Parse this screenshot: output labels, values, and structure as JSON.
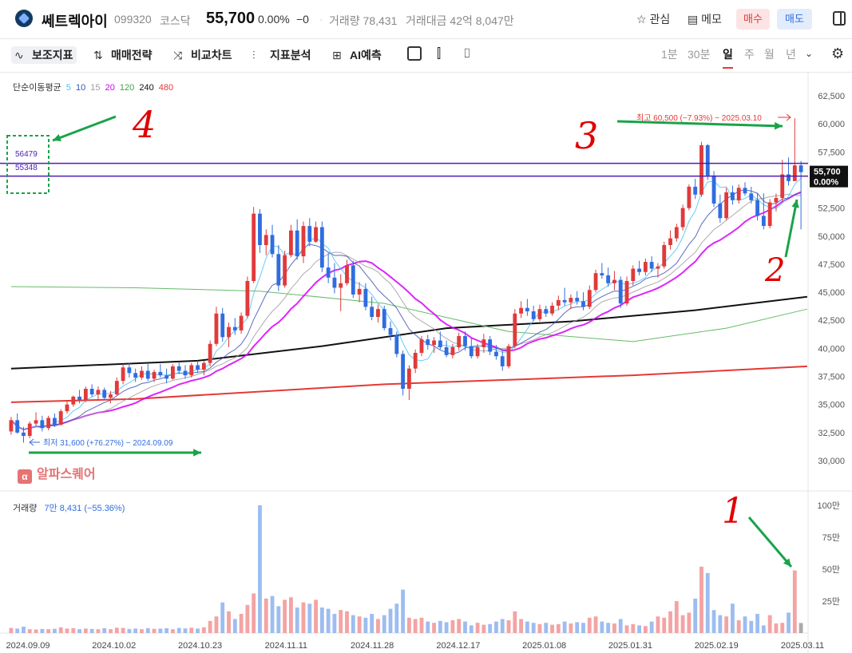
{
  "header": {
    "stock_name": "쎄트렉아이",
    "code": "099320",
    "market": "코스닥",
    "price": "55,700",
    "change_pct": "0.00%",
    "change_abs": "−0",
    "separator": "·",
    "volume": "거래량 78,431",
    "amount": "거래대금 42억 8,047만",
    "watch_label": "관심",
    "memo_label": "메모",
    "buy_label": "매수",
    "sell_label": "매도"
  },
  "toolbar": {
    "items": [
      "보조지표",
      "매매전략",
      "비교차트",
      "지표분석",
      "AI예측"
    ],
    "periods": [
      "1분",
      "30분",
      "일",
      "주",
      "월",
      "년"
    ],
    "selected_period": "일"
  },
  "legend": {
    "ma_title": "단순이동평균",
    "ma_periods": [
      "5",
      "10",
      "15",
      "20",
      "120",
      "240",
      "480"
    ],
    "volume_title": "거래량",
    "volume_value": "7만 8,431 (−55.36%)"
  },
  "watermark": "알파스퀘어",
  "colors": {
    "up": "#e03a3a",
    "down": "#2f6de0",
    "ma5": "#4fc3f7",
    "ma10": "#3f51b5",
    "ma15": "#9e9e9e",
    "ma20": "#d500f9",
    "ma120": "#66bb6a",
    "ma240": "#111111",
    "ma480": "#e53935",
    "annotation": "#e53935",
    "arrow": "#1aa34a"
  },
  "chart_data": {
    "type": "candlestick",
    "y_axis_ticks": [
      "62,500",
      "60,000",
      "57,500",
      "55,000",
      "52,500",
      "50,000",
      "47,500",
      "45,000",
      "42,500",
      "40,000",
      "37,500",
      "35,000",
      "32,500",
      "30,000"
    ],
    "y_range": [
      28500,
      63500
    ],
    "x_axis_labels": [
      "2024.09.09",
      "2024.10.02",
      "2024.10.23",
      "2024.11.11",
      "2024.11.28",
      "2024.12.17",
      "2025.01.08",
      "2025.01.31",
      "2025.02.19",
      "2025.03.11"
    ],
    "current_price_label": "55,700",
    "current_pct_label": "0.00%",
    "high_annotation": "최고 60,500 (−7.93%) − 2025.03.10",
    "low_annotation": "최저 31,600 (+76.27%) − 2024.09.09",
    "horizontal_lines": [
      {
        "label": "56479",
        "value": 56479
      },
      {
        "label": "55348",
        "value": 55348
      }
    ],
    "volume_axis_ticks": [
      "100만",
      "75만",
      "50만",
      "25만"
    ],
    "volume_range": [
      0,
      1000000
    ],
    "hand_annotations": [
      "1",
      "2",
      "3",
      "4"
    ],
    "candles": [
      [
        32600,
        33900,
        32300,
        33600
      ],
      [
        33600,
        34200,
        32400,
        32500
      ],
      [
        32500,
        33000,
        31600,
        32200
      ],
      [
        32200,
        33500,
        32000,
        33300
      ],
      [
        33300,
        34300,
        33100,
        33600
      ],
      [
        33600,
        34000,
        32600,
        32900
      ],
      [
        32900,
        34000,
        32700,
        33800
      ],
      [
        33800,
        34200,
        33000,
        33200
      ],
      [
        33200,
        34600,
        33100,
        34400
      ],
      [
        34400,
        35300,
        34200,
        35000
      ],
      [
        35000,
        35800,
        34800,
        35700
      ],
      [
        35700,
        36300,
        35100,
        35400
      ],
      [
        35400,
        36600,
        35200,
        36400
      ],
      [
        36400,
        36800,
        35700,
        35900
      ],
      [
        35900,
        36600,
        35400,
        36300
      ],
      [
        36300,
        36500,
        35400,
        35600
      ],
      [
        35600,
        36200,
        35100,
        35900
      ],
      [
        35900,
        37400,
        35800,
        37100
      ],
      [
        37100,
        38600,
        36800,
        38300
      ],
      [
        38300,
        38700,
        37400,
        37800
      ],
      [
        37800,
        38200,
        37000,
        37400
      ],
      [
        37400,
        38400,
        37200,
        38000
      ],
      [
        38000,
        38600,
        37100,
        37300
      ],
      [
        37300,
        38100,
        37000,
        37900
      ],
      [
        37900,
        38600,
        37400,
        37600
      ],
      [
        37600,
        38200,
        36900,
        37300
      ],
      [
        37300,
        38600,
        37200,
        38400
      ],
      [
        38400,
        38800,
        37700,
        38000
      ],
      [
        38000,
        38500,
        37300,
        37600
      ],
      [
        37600,
        38700,
        37400,
        38500
      ],
      [
        38500,
        38900,
        37800,
        38100
      ],
      [
        38100,
        38900,
        37600,
        38700
      ],
      [
        38700,
        40700,
        38400,
        40400
      ],
      [
        40400,
        43700,
        40200,
        43100
      ],
      [
        43100,
        43600,
        40600,
        41000
      ],
      [
        41000,
        42300,
        40100,
        41900
      ],
      [
        41900,
        42700,
        41200,
        41600
      ],
      [
        41600,
        43200,
        41300,
        42900
      ],
      [
        42900,
        46400,
        42700,
        46000
      ],
      [
        46000,
        52600,
        45800,
        52000
      ],
      [
        52000,
        52400,
        48500,
        49200
      ],
      [
        49200,
        50600,
        48300,
        50100
      ],
      [
        50100,
        51000,
        48100,
        48400
      ],
      [
        48400,
        49200,
        45100,
        45600
      ],
      [
        45600,
        48700,
        45400,
        48300
      ],
      [
        48300,
        51000,
        48100,
        50500
      ],
      [
        50500,
        51500,
        47900,
        48200
      ],
      [
        48200,
        51300,
        47600,
        50900
      ],
      [
        50900,
        51600,
        49100,
        49500
      ],
      [
        49500,
        51300,
        49400,
        50800
      ],
      [
        50800,
        51300,
        46800,
        47200
      ],
      [
        47200,
        48500,
        45800,
        46300
      ],
      [
        46300,
        47600,
        44900,
        45400
      ],
      [
        45400,
        46600,
        43300,
        45800
      ],
      [
        45800,
        47900,
        45600,
        47400
      ],
      [
        47400,
        47800,
        44500,
        44800
      ],
      [
        44800,
        45900,
        44100,
        45300
      ],
      [
        45300,
        45800,
        43400,
        43700
      ],
      [
        43700,
        44600,
        42500,
        42800
      ],
      [
        42800,
        43900,
        42300,
        43500
      ],
      [
        43500,
        43800,
        41600,
        41800
      ],
      [
        41800,
        42400,
        40700,
        41200
      ],
      [
        41200,
        41500,
        39200,
        39500
      ],
      [
        39500,
        39800,
        35800,
        36400
      ],
      [
        36400,
        38500,
        35400,
        38200
      ],
      [
        38200,
        39900,
        37800,
        39600
      ],
      [
        39600,
        41100,
        39300,
        40800
      ],
      [
        40800,
        41200,
        39900,
        40300
      ],
      [
        40300,
        41000,
        39600,
        40700
      ],
      [
        40700,
        41500,
        39900,
        40100
      ],
      [
        40100,
        40700,
        39200,
        39400
      ],
      [
        39400,
        40400,
        39100,
        40100
      ],
      [
        40100,
        41400,
        39800,
        41100
      ],
      [
        41100,
        41500,
        39800,
        40200
      ],
      [
        40200,
        40900,
        39100,
        39300
      ],
      [
        39300,
        40400,
        39100,
        40100
      ],
      [
        40100,
        41300,
        39600,
        40800
      ],
      [
        40800,
        41100,
        39400,
        39700
      ],
      [
        39700,
        40300,
        39000,
        39300
      ],
      [
        39300,
        39800,
        38000,
        38400
      ],
      [
        38400,
        40400,
        38200,
        40200
      ],
      [
        40200,
        43500,
        40000,
        43100
      ],
      [
        43100,
        44200,
        42700,
        43600
      ],
      [
        43600,
        44400,
        42900,
        43300
      ],
      [
        43300,
        43800,
        42400,
        42600
      ],
      [
        42600,
        43900,
        42400,
        43500
      ],
      [
        43500,
        43800,
        42800,
        43100
      ],
      [
        43100,
        44100,
        42900,
        43800
      ],
      [
        43800,
        44700,
        43400,
        44300
      ],
      [
        44300,
        45400,
        43800,
        44100
      ],
      [
        44100,
        44800,
        43500,
        44500
      ],
      [
        44500,
        45100,
        43900,
        44200
      ],
      [
        44200,
        45000,
        43400,
        43700
      ],
      [
        43700,
        45600,
        43500,
        45200
      ],
      [
        45200,
        47000,
        45000,
        46700
      ],
      [
        46700,
        47600,
        46200,
        46500
      ],
      [
        46500,
        47200,
        45500,
        45800
      ],
      [
        45800,
        46900,
        45200,
        46100
      ],
      [
        46100,
        46400,
        43600,
        44000
      ],
      [
        44000,
        46400,
        43800,
        46000
      ],
      [
        46000,
        47400,
        45600,
        47100
      ],
      [
        47100,
        47800,
        46500,
        46800
      ],
      [
        46800,
        48000,
        46500,
        47700
      ],
      [
        47700,
        48200,
        46800,
        47100
      ],
      [
        47100,
        47600,
        46300,
        47300
      ],
      [
        47300,
        49500,
        47100,
        49200
      ],
      [
        49200,
        50500,
        48800,
        49800
      ],
      [
        49800,
        51100,
        49500,
        50800
      ],
      [
        50800,
        52800,
        50500,
        52500
      ],
      [
        52500,
        54600,
        52300,
        54400
      ],
      [
        54400,
        55100,
        53300,
        53700
      ],
      [
        53700,
        58400,
        53500,
        58100
      ],
      [
        58100,
        58200,
        55000,
        55400
      ],
      [
        55400,
        55800,
        52600,
        52900
      ],
      [
        52900,
        53700,
        51200,
        51600
      ],
      [
        51600,
        54300,
        51400,
        53900
      ],
      [
        53900,
        54500,
        52800,
        53200
      ],
      [
        53200,
        54600,
        52900,
        54300
      ],
      [
        54300,
        54800,
        53600,
        53800
      ],
      [
        53800,
        54400,
        52900,
        53200
      ],
      [
        53200,
        53800,
        51400,
        51800
      ],
      [
        51800,
        53800,
        50600,
        50900
      ],
      [
        50900,
        53300,
        50700,
        53000
      ],
      [
        53000,
        53800,
        52200,
        53400
      ],
      [
        53400,
        56800,
        53100,
        55500
      ],
      [
        55500,
        57000,
        54500,
        54900
      ],
      [
        54900,
        60500,
        54900,
        56300
      ],
      [
        56300,
        56700,
        50600,
        55700
      ]
    ],
    "volumes": [
      40000,
      35000,
      50000,
      30000,
      28000,
      32000,
      30000,
      33000,
      45000,
      35000,
      38000,
      30000,
      35000,
      32000,
      30000,
      38000,
      30000,
      42000,
      40000,
      32000,
      35000,
      30000,
      38000,
      33000,
      35000,
      38000,
      30000,
      40000,
      36000,
      42000,
      35000,
      45000,
      95000,
      130000,
      240000,
      170000,
      110000,
      150000,
      220000,
      310000,
      1000000,
      270000,
      290000,
      210000,
      260000,
      280000,
      200000,
      240000,
      230000,
      260000,
      200000,
      190000,
      150000,
      180000,
      170000,
      140000,
      130000,
      120000,
      150000,
      110000,
      140000,
      190000,
      230000,
      340000,
      120000,
      110000,
      120000,
      90000,
      80000,
      95000,
      85000,
      100000,
      110000,
      90000,
      60000,
      80000,
      65000,
      70000,
      90000,
      110000,
      100000,
      170000,
      110000,
      90000,
      80000,
      70000,
      80000,
      65000,
      70000,
      90000,
      75000,
      85000,
      80000,
      120000,
      130000,
      90000,
      80000,
      75000,
      110000,
      60000,
      70000,
      60000,
      55000,
      90000,
      130000,
      120000,
      170000,
      250000,
      140000,
      160000,
      270000,
      520000,
      470000,
      180000,
      140000,
      130000,
      230000,
      100000,
      130000,
      95000,
      150000,
      60000,
      140000,
      75000,
      80000,
      160000,
      490000,
      78431
    ]
  }
}
